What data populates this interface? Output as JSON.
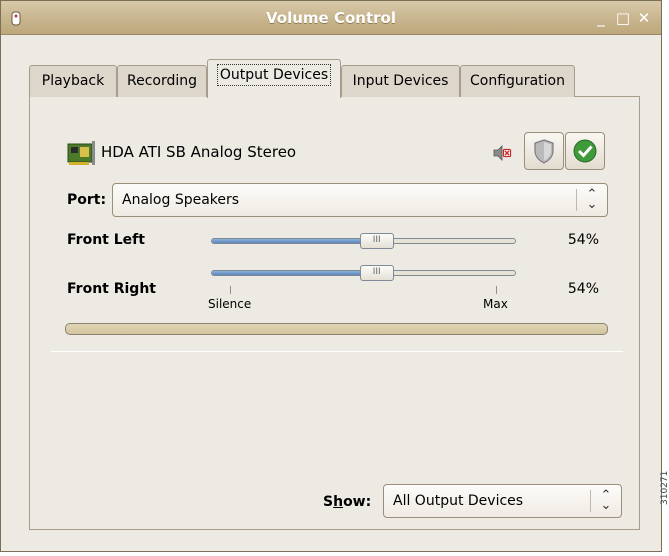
{
  "window": {
    "title": "Volume Control",
    "minimize_glyph": "_",
    "maximize_glyph": "□",
    "close_glyph": "✕"
  },
  "tabs": [
    {
      "label": "Playback",
      "active": false
    },
    {
      "label": "Recording",
      "active": false
    },
    {
      "label": "Output Devices",
      "active": true
    },
    {
      "label": "Input Devices",
      "active": false
    },
    {
      "label": "Configuration",
      "active": false
    }
  ],
  "device": {
    "name": "HDA ATI SB Analog Stereo",
    "icon": "sound-card-icon",
    "mute_icon": "muted-speaker-icon",
    "lock_icon": "shield-icon",
    "default_icon": "checkmark-icon"
  },
  "port": {
    "label": "Port:",
    "value": "Analog Speakers"
  },
  "channels": [
    {
      "label": "Front Left",
      "percent_text": "54%",
      "level": 0.54
    },
    {
      "label": "Front Right",
      "percent_text": "54%",
      "level": 0.54
    }
  ],
  "scale": {
    "min_label": "Silence",
    "max_label": "Max"
  },
  "peak_meter": {
    "level": 0.0
  },
  "show": {
    "label": "Show:",
    "value": "All Output Devices"
  },
  "side_text": "310271",
  "colors": {
    "titlebar": "#c8b58e",
    "slider_fill": "#5b86bb",
    "default_check": "#3f9a3a"
  }
}
